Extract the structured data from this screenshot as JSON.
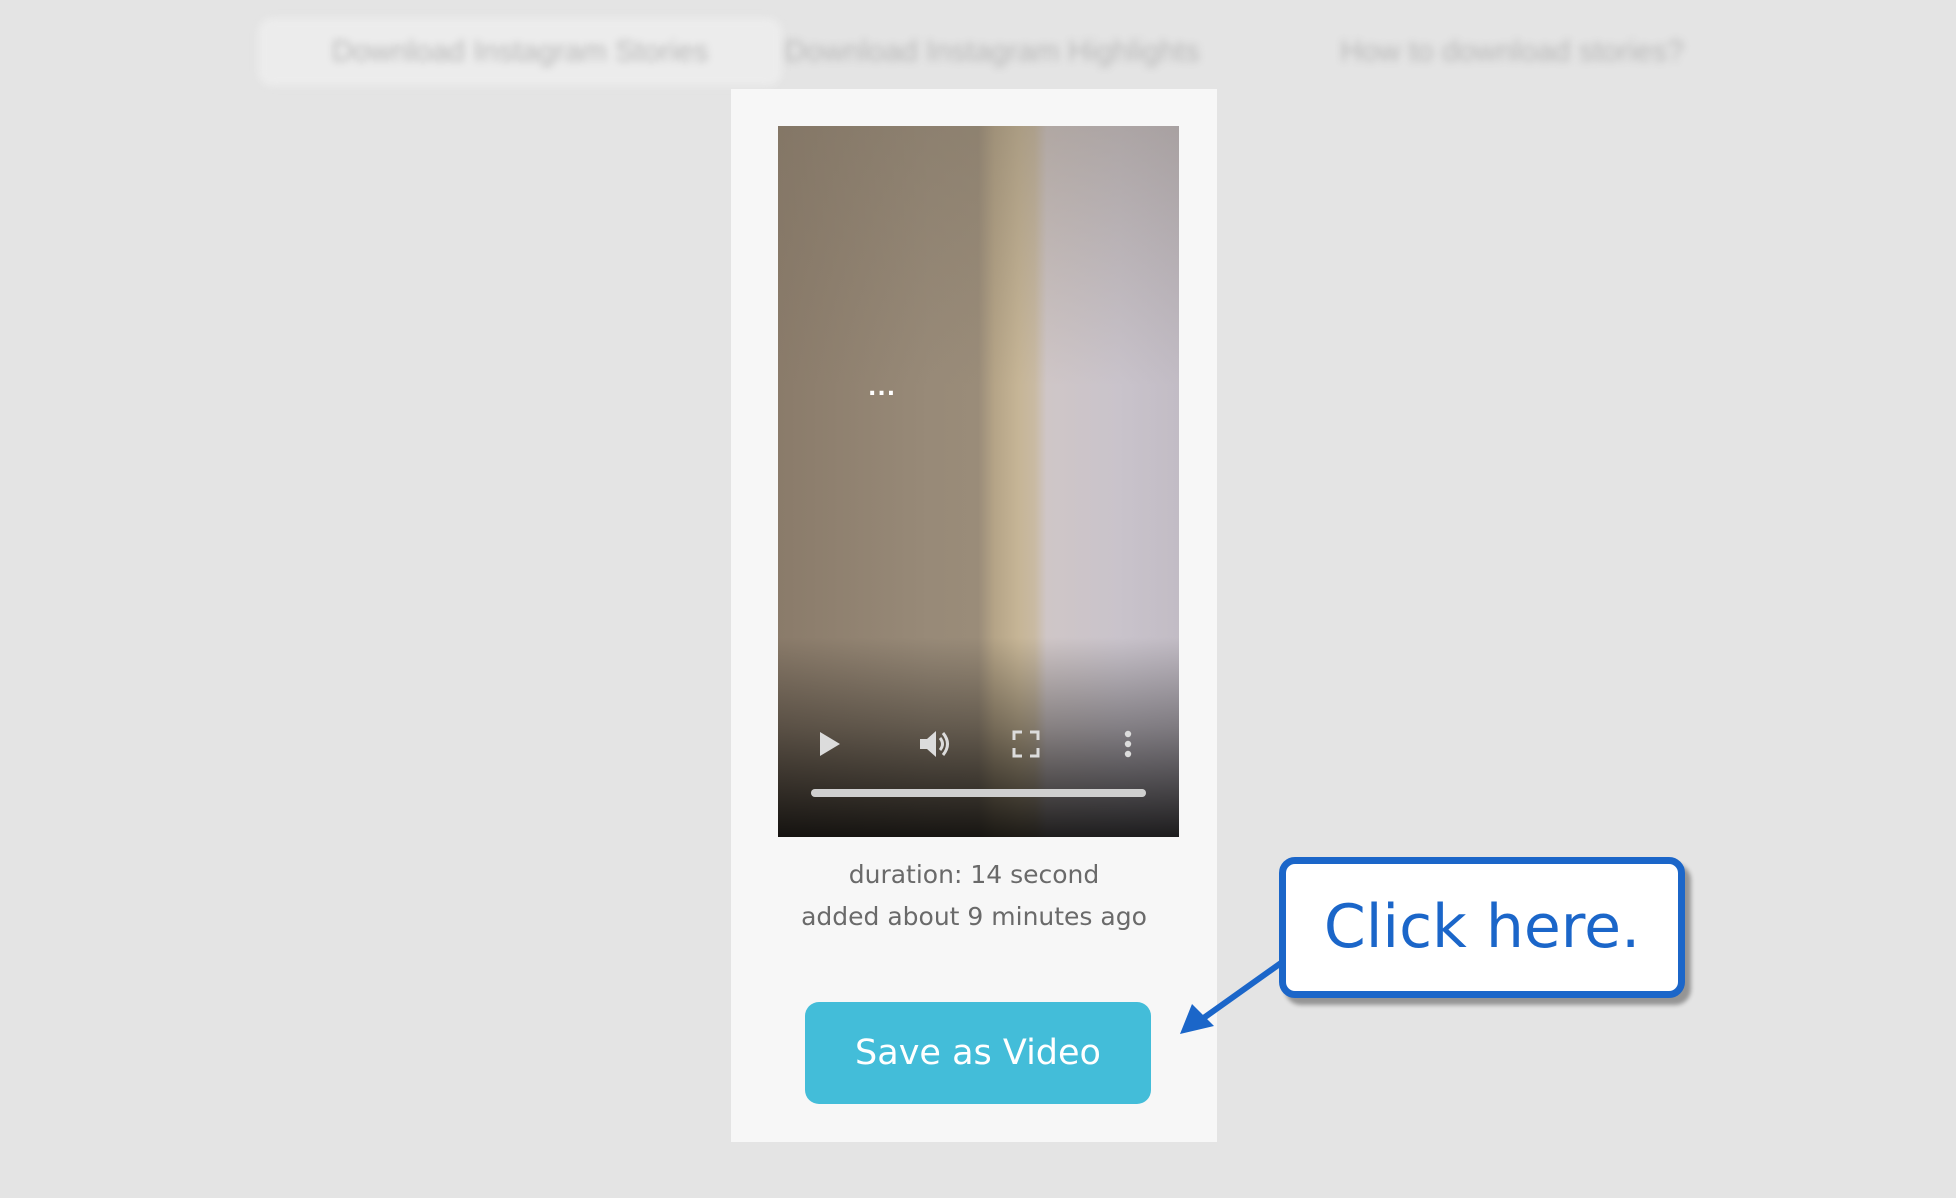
{
  "nav": {
    "items": [
      {
        "label": "Download Instagram Stories"
      },
      {
        "label": "Download Instagram Highlights"
      },
      {
        "label": "How to download stories?"
      }
    ]
  },
  "video": {
    "overlay_text": "...",
    "progress": 1.0,
    "icons": {
      "play": "play-icon",
      "volume": "volume-icon",
      "fullscreen": "fullscreen-icon",
      "more": "more-vertical-icon"
    }
  },
  "meta": {
    "duration": "duration: 14 second",
    "added": "added about 9 minutes ago"
  },
  "actions": {
    "save_label": "Save as Video"
  },
  "callout": {
    "text": "Click here."
  },
  "colors": {
    "button": "#43bdd9",
    "callout_border": "#1b66c9",
    "page_background": "#e4e4e4"
  }
}
